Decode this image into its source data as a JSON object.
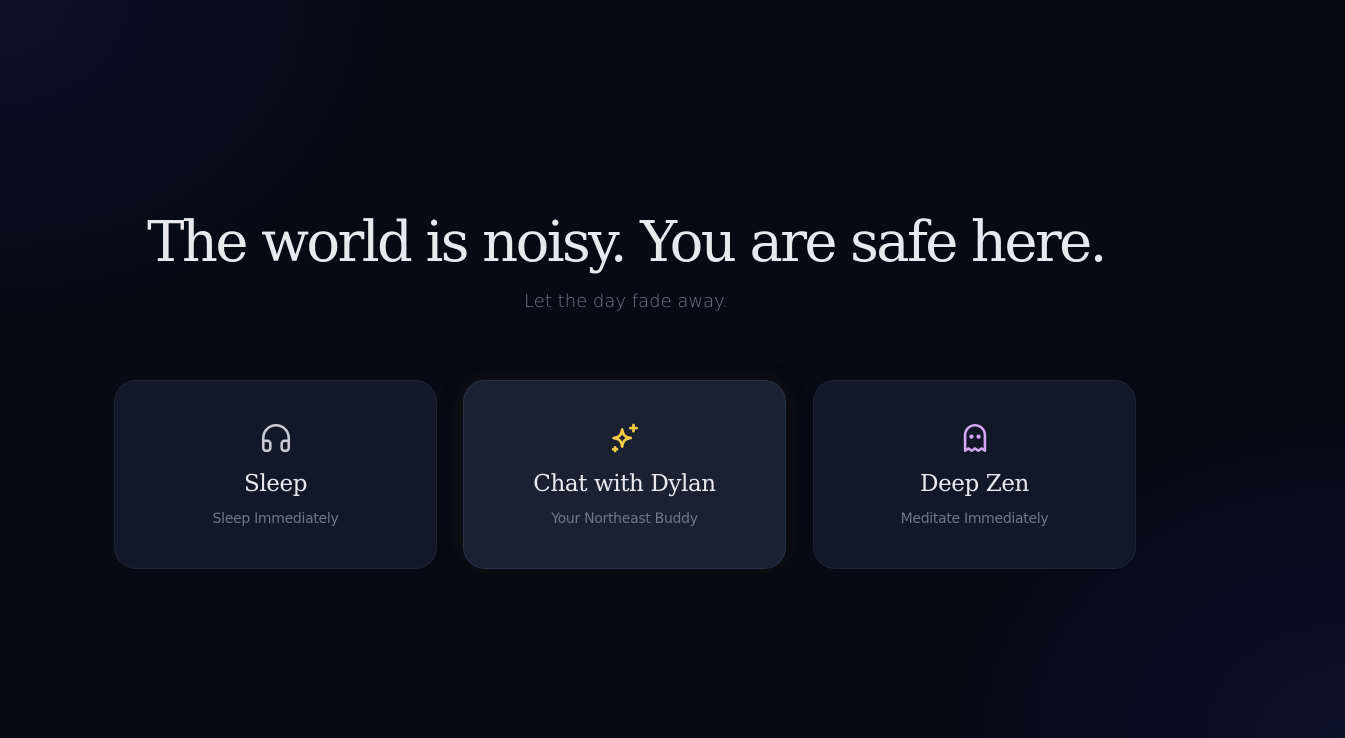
{
  "hero": {
    "headline": "The world is noisy. You are safe here.",
    "subline": "Let the day fade away."
  },
  "cards": [
    {
      "title": "Sleep",
      "description": "Sleep Immediately",
      "icon": "headphones-icon",
      "icon_color": "#c9ccd4"
    },
    {
      "title": "Chat with Dylan",
      "description": "Your Northeast Buddy",
      "icon": "sparkles-icon",
      "icon_color": "#f7c948"
    },
    {
      "title": "Deep Zen",
      "description": "Meditate Immediately",
      "icon": "ghost-icon",
      "icon_color": "#d5a6f4"
    }
  ],
  "theme": {
    "background": "#050a15",
    "card_background": "#111928",
    "text_primary": "#e8e9ee",
    "text_muted": "#727887"
  }
}
